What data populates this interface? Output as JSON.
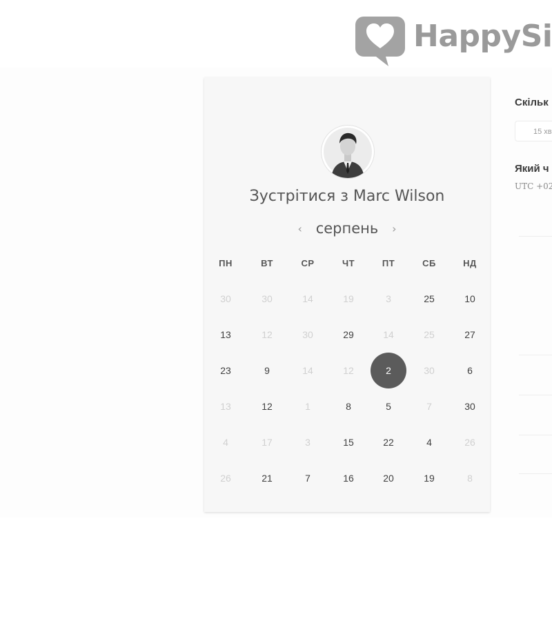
{
  "brand": {
    "name": "HappySig",
    "logo_icon": "heart-speech-bubble-icon",
    "color": "#9a9a9a"
  },
  "scheduler": {
    "title": "Зустрітися з Marc Wilson",
    "avatar_icon": "person-photo",
    "month": "серпень",
    "prev_icon": "chevron-left-icon",
    "next_icon": "chevron-right-icon",
    "weekdays": [
      "ПН",
      "ВТ",
      "СР",
      "ЧТ",
      "ПТ",
      "СБ",
      "НД"
    ],
    "weeks": [
      [
        {
          "n": "30",
          "s": "dim"
        },
        {
          "n": "30",
          "s": "dim"
        },
        {
          "n": "14",
          "s": "dim"
        },
        {
          "n": "19",
          "s": "dim"
        },
        {
          "n": "3",
          "s": "dim"
        },
        {
          "n": "25",
          "s": "norm"
        },
        {
          "n": "10",
          "s": "norm"
        }
      ],
      [
        {
          "n": "13",
          "s": "norm"
        },
        {
          "n": "12",
          "s": "dim"
        },
        {
          "n": "30",
          "s": "dim"
        },
        {
          "n": "29",
          "s": "norm"
        },
        {
          "n": "14",
          "s": "dim"
        },
        {
          "n": "25",
          "s": "dim"
        },
        {
          "n": "27",
          "s": "norm"
        }
      ],
      [
        {
          "n": "23",
          "s": "norm"
        },
        {
          "n": "9",
          "s": "norm"
        },
        {
          "n": "14",
          "s": "dim"
        },
        {
          "n": "12",
          "s": "dim"
        },
        {
          "n": "2",
          "s": "sel"
        },
        {
          "n": "30",
          "s": "dim"
        },
        {
          "n": "6",
          "s": "norm"
        }
      ],
      [
        {
          "n": "13",
          "s": "dim"
        },
        {
          "n": "12",
          "s": "norm"
        },
        {
          "n": "1",
          "s": "dim"
        },
        {
          "n": "8",
          "s": "norm"
        },
        {
          "n": "5",
          "s": "norm"
        },
        {
          "n": "7",
          "s": "dim"
        },
        {
          "n": "30",
          "s": "norm"
        }
      ],
      [
        {
          "n": "4",
          "s": "dim"
        },
        {
          "n": "17",
          "s": "dim"
        },
        {
          "n": "3",
          "s": "dim"
        },
        {
          "n": "15",
          "s": "norm"
        },
        {
          "n": "22",
          "s": "norm"
        },
        {
          "n": "4",
          "s": "norm"
        },
        {
          "n": "26",
          "s": "dim"
        }
      ],
      [
        {
          "n": "26",
          "s": "dim"
        },
        {
          "n": "21",
          "s": "norm"
        },
        {
          "n": "7",
          "s": "norm"
        },
        {
          "n": "16",
          "s": "norm"
        },
        {
          "n": "20",
          "s": "norm"
        },
        {
          "n": "19",
          "s": "norm"
        },
        {
          "n": "8",
          "s": "dim"
        }
      ]
    ]
  },
  "side": {
    "duration_heading": "Скільк",
    "duration_value": "15 хв",
    "time_heading": "Який ч",
    "timezone": "UTC +02"
  },
  "colors": {
    "selected_day": "#5b5b5b",
    "dim_day": "#d0d0d0",
    "text": "#3f3f3f"
  }
}
